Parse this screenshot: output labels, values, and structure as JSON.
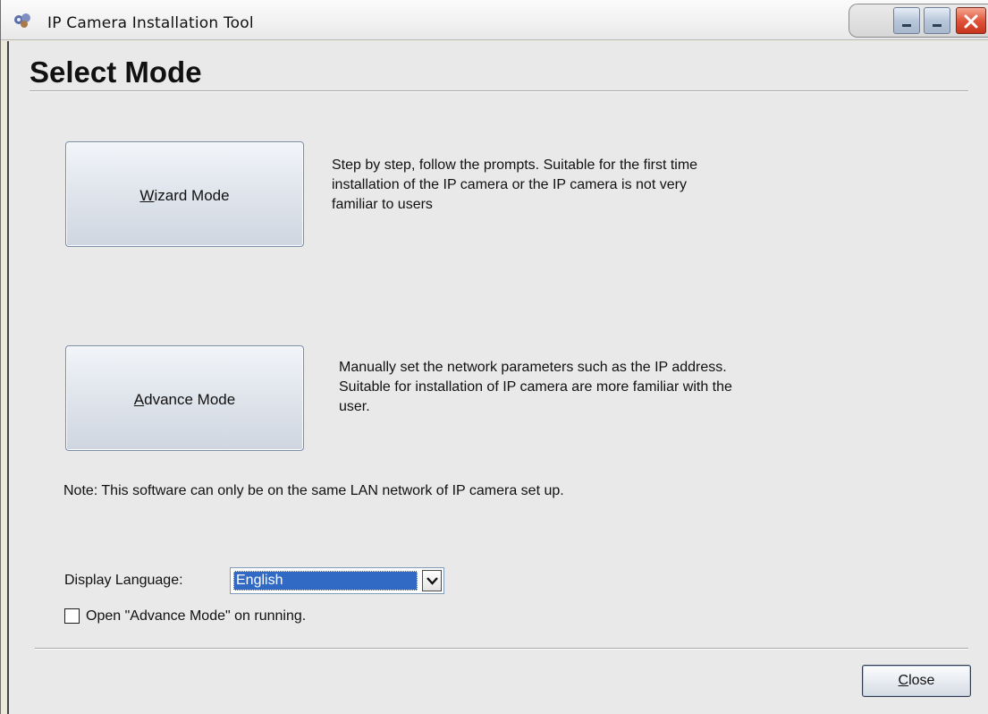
{
  "window": {
    "title": "IP Camera Installation Tool",
    "app_icon": "ip-camera-app-icon",
    "controls": [
      "minimize-icon",
      "maximize-icon",
      "close-icon"
    ]
  },
  "page": {
    "heading": "Select Mode"
  },
  "modes": [
    {
      "accel": "W",
      "label_rest": "izard Mode",
      "description_lines": [
        "Step by step, follow the prompts. Suitable for the first time",
        "installation of the IP camera or the IP camera is not very",
        "familiar to users"
      ]
    },
    {
      "accel": "A",
      "label_rest": "dvance Mode",
      "description_lines": [
        "Manually set the network parameters such as the IP address.",
        "Suitable for installation of IP camera are more familiar with the",
        "user."
      ]
    }
  ],
  "note": "Note: This software can only be on the same LAN network of IP camera set up.",
  "language": {
    "label": "Display Language:",
    "selected": "English"
  },
  "open_advance_checkbox": {
    "label": "Open \"Advance Mode\" on running.",
    "checked": false
  },
  "footer": {
    "close_accel": "C",
    "close_rest": "lose"
  },
  "colors": {
    "selection": "#316ac5",
    "window_bg": "#e9e9e9",
    "close_red": "#e0553b"
  }
}
